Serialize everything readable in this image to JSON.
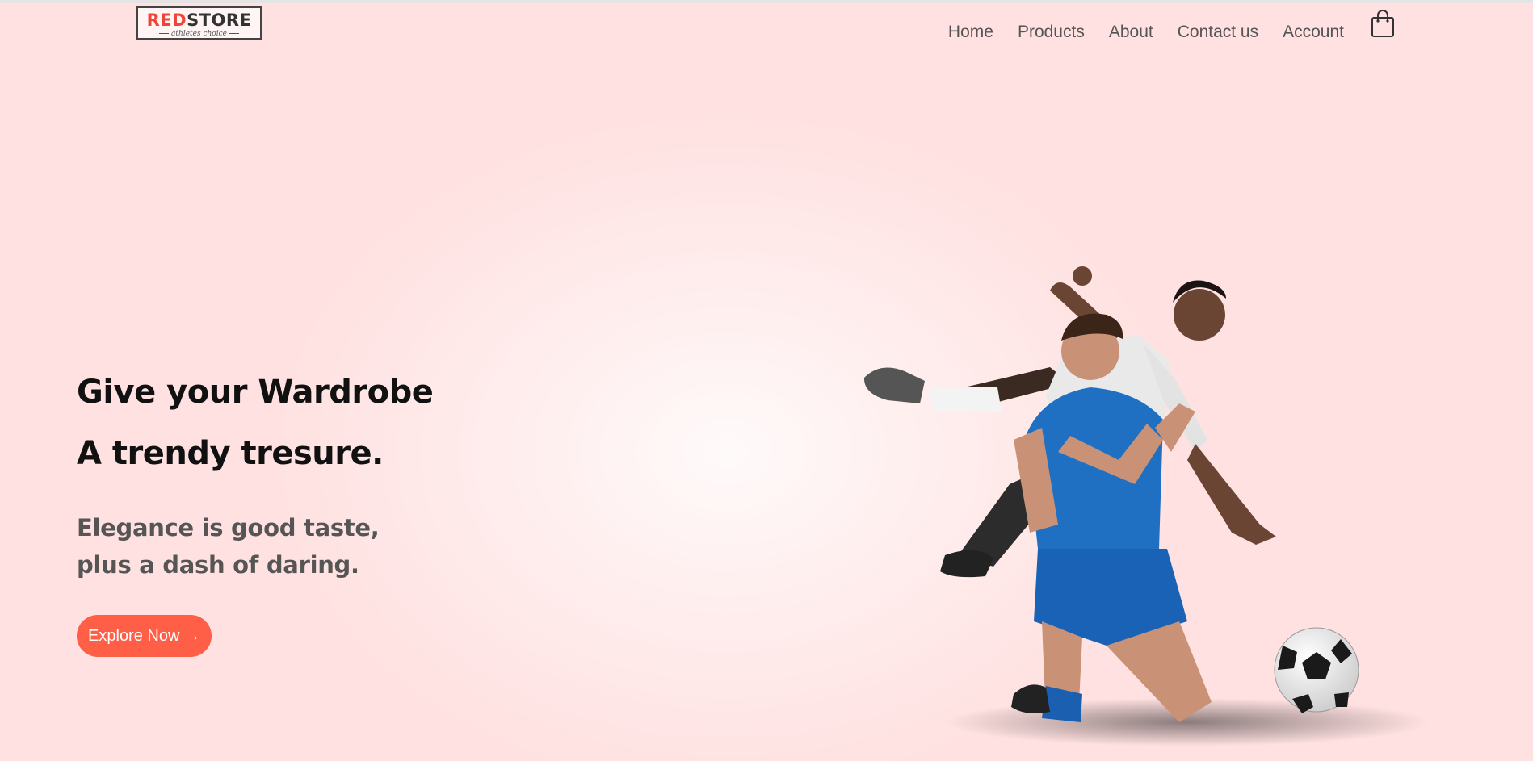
{
  "brand": {
    "name_red": "RED",
    "name_dark": "STORE",
    "tagline": "athletes choice",
    "accent": "#ff5e47"
  },
  "nav": {
    "items": [
      {
        "label": "Home"
      },
      {
        "label": "Products"
      },
      {
        "label": "About"
      },
      {
        "label": "Contact us"
      },
      {
        "label": "Account"
      }
    ],
    "cart_icon": "shopping-bag-icon"
  },
  "hero": {
    "title_line1": "Give your Wardrobe",
    "title_line2": "A trendy tresure.",
    "subtitle_line1": "Elegance is good taste,",
    "subtitle_line2": "plus a dash of daring.",
    "cta_label": "Explore Now →",
    "image": "football-players-celebration"
  }
}
